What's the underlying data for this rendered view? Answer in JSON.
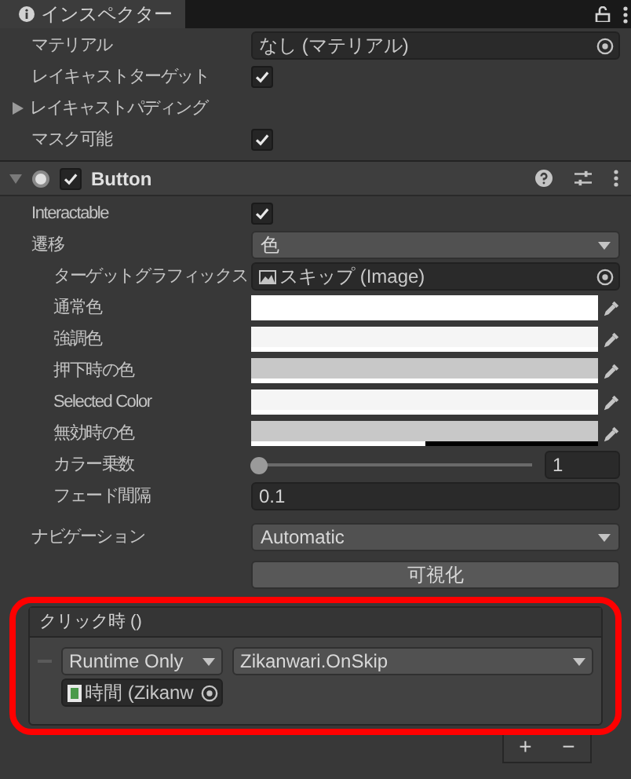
{
  "tab": {
    "title": "インスペクター"
  },
  "image_rows": [
    {
      "kind": "object",
      "label": "マテリアル",
      "value": "なし (マテリアル)"
    },
    {
      "kind": "checkbox",
      "label": "レイキャストターゲット",
      "checked": true
    },
    {
      "kind": "foldout",
      "label": "レイキャストパディング",
      "expanded": false
    },
    {
      "kind": "checkbox",
      "label": "マスク可能",
      "checked": true
    }
  ],
  "component": {
    "title": "Button",
    "expanded": true,
    "enabled": true
  },
  "rows": [
    {
      "kind": "checkbox",
      "label": "Interactable",
      "checked": true
    },
    {
      "kind": "dropdown",
      "label": "遷移",
      "value": "色",
      "children": [
        {
          "kind": "object",
          "label": "ターゲットグラフィックス",
          "value": "スキップ (Image)"
        },
        {
          "kind": "color",
          "label": "通常色",
          "color": "#ffffff",
          "level": 1
        },
        {
          "kind": "color",
          "label": "強調色",
          "color": "#f5f5f5",
          "level": 1
        },
        {
          "kind": "color",
          "label": "押下時の色",
          "color": "#c8c8c8",
          "level": 1
        },
        {
          "kind": "color",
          "label": "Selected Color",
          "color": "#f5f5f5",
          "level": 1
        },
        {
          "kind": "color",
          "label": "無効時の色",
          "color": "#c8c8c8",
          "level": 0.5
        },
        {
          "kind": "slider",
          "label": "カラー乗数",
          "level": 0,
          "reading": "1"
        },
        {
          "kind": "text",
          "label": "フェード間隔",
          "value": "0.1"
        }
      ]
    },
    {
      "kind": "dropdown",
      "label": "ナビゲーション",
      "value": "Automatic"
    }
  ],
  "visualize_button": "可視化",
  "event": {
    "title": "クリック時 ()",
    "entries": [
      {
        "mode": "Runtime Only",
        "function": "Zikanwari.OnSkip",
        "target": "時間 (Zikanw"
      }
    ]
  },
  "list_buttons": [
    "+",
    "−"
  ]
}
